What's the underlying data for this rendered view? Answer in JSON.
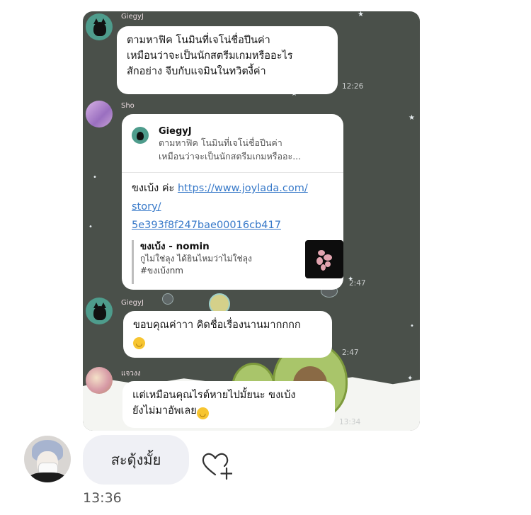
{
  "chat": {
    "messages": [
      {
        "sender": "GiegyJ",
        "lines": [
          "ตามหาฟิค โนมินที่เจโน่ชื่อปีนค่า",
          "เหมือนว่าจะเป็นนักสตรีมเกมหรืออะไร",
          "สักอย่าง จีบกับแจมินในทวิตงี้ค่า"
        ],
        "time": "12:26"
      },
      {
        "sender": "Sho",
        "reply": {
          "name": "GiegyJ",
          "lines": [
            "ตามหาฟิค โนมินที่เจโน่ชื่อปีนค่า",
            "เหมือนว่าจะเป็นนักสตรีมเกมหรืออะ..."
          ]
        },
        "prefix": "ขงเบ้ง ค่ะ ",
        "link_lines": [
          "https://www.joylada.com/",
          "story/",
          "5e393f8f247bae00016cb417"
        ],
        "preview": {
          "title": "ขงเบ้ง - nomin",
          "desc_lines": [
            "กูไม่ใช่ลุง ได้ยินไหมว่าไม่ใช่ลุง",
            "#ขงเบ้งnm"
          ]
        },
        "time": "2:47"
      },
      {
        "sender": "GiegyJ",
        "lines": [
          "ขอบคุณค่าาา คิดชื่อเรื่องนานมากกกก"
        ],
        "emoji": "😂",
        "time": "2:47"
      },
      {
        "sender": "แจวงง",
        "lines": [
          "แต่เหมือนคุณไรต์หายไปมั้ยนะ ขงเบ้ง",
          "ยังไม่มาอัพเลย"
        ],
        "emoji": "😂",
        "time": "13:34"
      }
    ]
  },
  "comment": {
    "text": "สะดุ้งมั้ย",
    "time": "13:36",
    "like_icon": "heart-plus-icon"
  },
  "colors": {
    "chat_bg": "#4a504a",
    "bubble": "#ffffff",
    "link": "#3779c9",
    "comment_bubble": "#eff0f5"
  }
}
